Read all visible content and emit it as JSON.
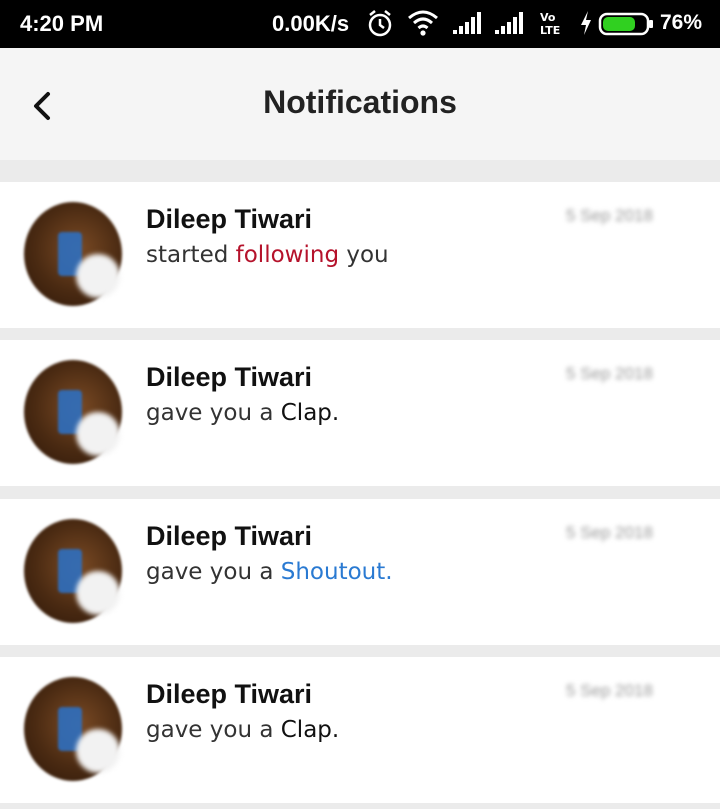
{
  "status_bar": {
    "time": "4:20 PM",
    "net_speed": "0.00K/s",
    "battery_percent": "76%",
    "battery_level": 0.76,
    "icons": [
      "alarm-icon",
      "wifi-icon",
      "signal-icon",
      "signal-icon",
      "volte-icon",
      "charging-icon",
      "battery-icon"
    ]
  },
  "header": {
    "title": "Notifications",
    "back_icon": "chevron-left-icon"
  },
  "notifications": [
    {
      "name": "Dileep Tiwari",
      "prefix": "started ",
      "action": "following",
      "suffix": " you",
      "date": "5 Sep 2018",
      "action_color": "#b5122b"
    },
    {
      "name": "Dileep Tiwari",
      "prefix": "gave you a ",
      "action": "Clap.",
      "suffix": "",
      "date": "5 Sep 2018",
      "action_color": "#111111"
    },
    {
      "name": "Dileep Tiwari",
      "prefix": "gave you a ",
      "action": "Shoutout.",
      "suffix": "",
      "date": "5 Sep 2018",
      "action_color": "#2a7ad2"
    },
    {
      "name": "Dileep Tiwari",
      "prefix": "gave you a ",
      "action": "Clap.",
      "suffix": "",
      "date": "5 Sep 2018",
      "action_color": "#111111"
    }
  ]
}
